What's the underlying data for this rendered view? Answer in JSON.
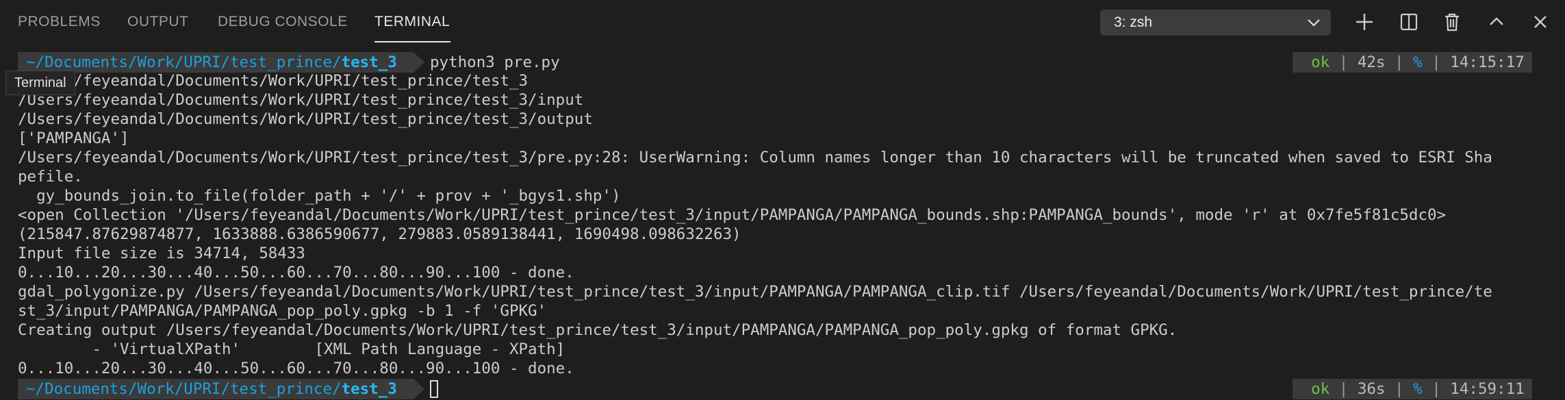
{
  "tabs": [
    {
      "label": "PROBLEMS"
    },
    {
      "label": "OUTPUT"
    },
    {
      "label": "DEBUG CONSOLE"
    },
    {
      "label": "TERMINAL"
    }
  ],
  "active_tab": "TERMINAL",
  "terminal_select": {
    "value": "3: zsh"
  },
  "icons": [
    "plus-icon",
    "split-icon",
    "trash-icon",
    "chevron-up-icon",
    "close-icon"
  ],
  "tooltip": "Terminal",
  "prompt1": {
    "path_prefix": "~/Documents/Work/UPRI/test_prince/",
    "path_dir": "test_3",
    "command": "python3 pre.py",
    "status_ok": "ok",
    "status_duration": "42s",
    "status_symbol": "%",
    "status_time": "14:15:17"
  },
  "output_lines": [
    "/Users/feyeandal/Documents/Work/UPRI/test_prince/test_3",
    "/Users/feyeandal/Documents/Work/UPRI/test_prince/test_3/input",
    "/Users/feyeandal/Documents/Work/UPRI/test_prince/test_3/output",
    "['PAMPANGA']",
    "/Users/feyeandal/Documents/Work/UPRI/test_prince/test_3/pre.py:28: UserWarning: Column names longer than 10 characters will be truncated when saved to ESRI Sha",
    "pefile.",
    "  gy_bounds_join.to_file(folder_path + '/' + prov + '_bgys1.shp')",
    "<open Collection '/Users/feyeandal/Documents/Work/UPRI/test_prince/test_3/input/PAMPANGA/PAMPANGA_bounds.shp:PAMPANGA_bounds', mode 'r' at 0x7fe5f81c5dc0>",
    "(215847.87629874877, 1633888.6386590677, 279883.0589138441, 1690498.098632263)",
    "Input file size is 34714, 58433",
    "0...10...20...30...40...50...60...70...80...90...100 - done.",
    "gdal_polygonize.py /Users/feyeandal/Documents/Work/UPRI/test_prince/test_3/input/PAMPANGA/PAMPANGA_clip.tif /Users/feyeandal/Documents/Work/UPRI/test_prince/te",
    "st_3/input/PAMPANGA/PAMPANGA_pop_poly.gpkg -b 1 -f 'GPKG'",
    "Creating output /Users/feyeandal/Documents/Work/UPRI/test_prince/test_3/input/PAMPANGA/PAMPANGA_pop_poly.gpkg of format GPKG.",
    "        - 'VirtualXPath'        [XML Path Language - XPath]",
    "0...10...20...30...40...50...60...70...80...90...100 - done."
  ],
  "prompt2": {
    "path_prefix": "~/Documents/Work/UPRI/test_prince/",
    "path_dir": "test_3",
    "status_ok": "ok",
    "status_duration": "36s",
    "status_symbol": "%",
    "status_time": "14:59:11"
  },
  "colors": {
    "background": "#1e1e1e",
    "path_blue": "#1aa0e0",
    "ok_green": "#6ec23c",
    "segment_bg": "#3a3a3a"
  }
}
